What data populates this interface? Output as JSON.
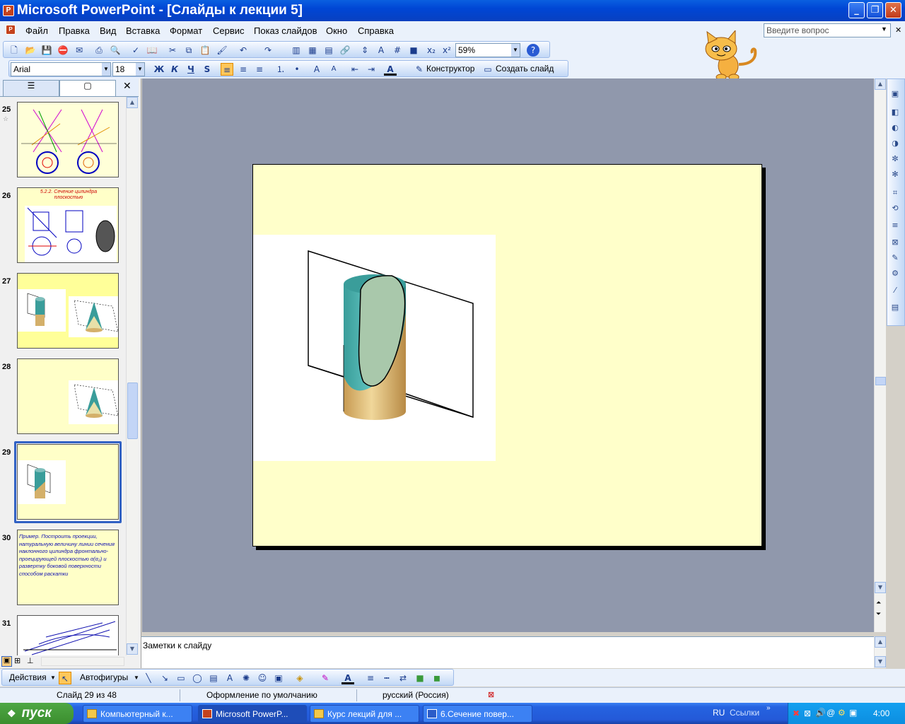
{
  "window": {
    "title": "Microsoft PowerPoint - [Слайды к лекции 5]",
    "app_icon": "powerpoint-icon"
  },
  "menu": [
    "Файл",
    "Правка",
    "Вид",
    "Вставка",
    "Формат",
    "Сервис",
    "Показ слайдов",
    "Окно",
    "Справка"
  ],
  "ask_box": {
    "placeholder": "Введите вопрос"
  },
  "standard_toolbar": {
    "zoom": "59%"
  },
  "formatting_toolbar": {
    "font": "Arial",
    "size": "18",
    "bold": "Ж",
    "italic": "К",
    "underline": "Ч",
    "shadow": "S",
    "designer": "Конструктор",
    "new_slide": "Создать слайд"
  },
  "slides_pane": {
    "thumbnails": [
      {
        "num": "25",
        "content": "schematic"
      },
      {
        "num": "26",
        "content": "title",
        "title": "5.2.2. Сечение цилиндра плоскостью"
      },
      {
        "num": "27",
        "content": "images"
      },
      {
        "num": "28",
        "content": "cone"
      },
      {
        "num": "29",
        "content": "cylinder",
        "selected": true
      },
      {
        "num": "30",
        "content": "text",
        "text": "Пример. Построить проекции, натуральную величину линии сечения наклонного цилиндра фронтально-проецирующей плоскостью α(α₂) и развертку боковой поверхности способом раскатки"
      },
      {
        "num": "31",
        "content": "diagram"
      }
    ]
  },
  "notes": {
    "placeholder": "Заметки к слайду"
  },
  "drawing_toolbar": {
    "actions": "Действия",
    "autoshapes": "Автофигуры"
  },
  "status_bar": {
    "slide": "Слайд 29 из 48",
    "design": "Оформление по умолчанию",
    "language": "русский (Россия)"
  },
  "taskbar": {
    "start": "пуск",
    "tasks": [
      {
        "label": "Компьютерный к...",
        "icon": "folder-icon"
      },
      {
        "label": "Microsoft PowerP...",
        "icon": "powerpoint-icon",
        "active": true
      },
      {
        "label": "Курс лекций для ...",
        "icon": "folder-icon"
      },
      {
        "label": "6.Сечение повер...",
        "icon": "word-icon"
      }
    ],
    "lang": "RU",
    "links": "Ссылки",
    "clock": "4:00"
  },
  "colors": {
    "slide_bg": "#ffffca",
    "workspace": "#9098ac",
    "cylinder_teal": "#3a9d9a",
    "cylinder_tan": "#d4b06a",
    "xp_blue": "#0a5fe0"
  }
}
